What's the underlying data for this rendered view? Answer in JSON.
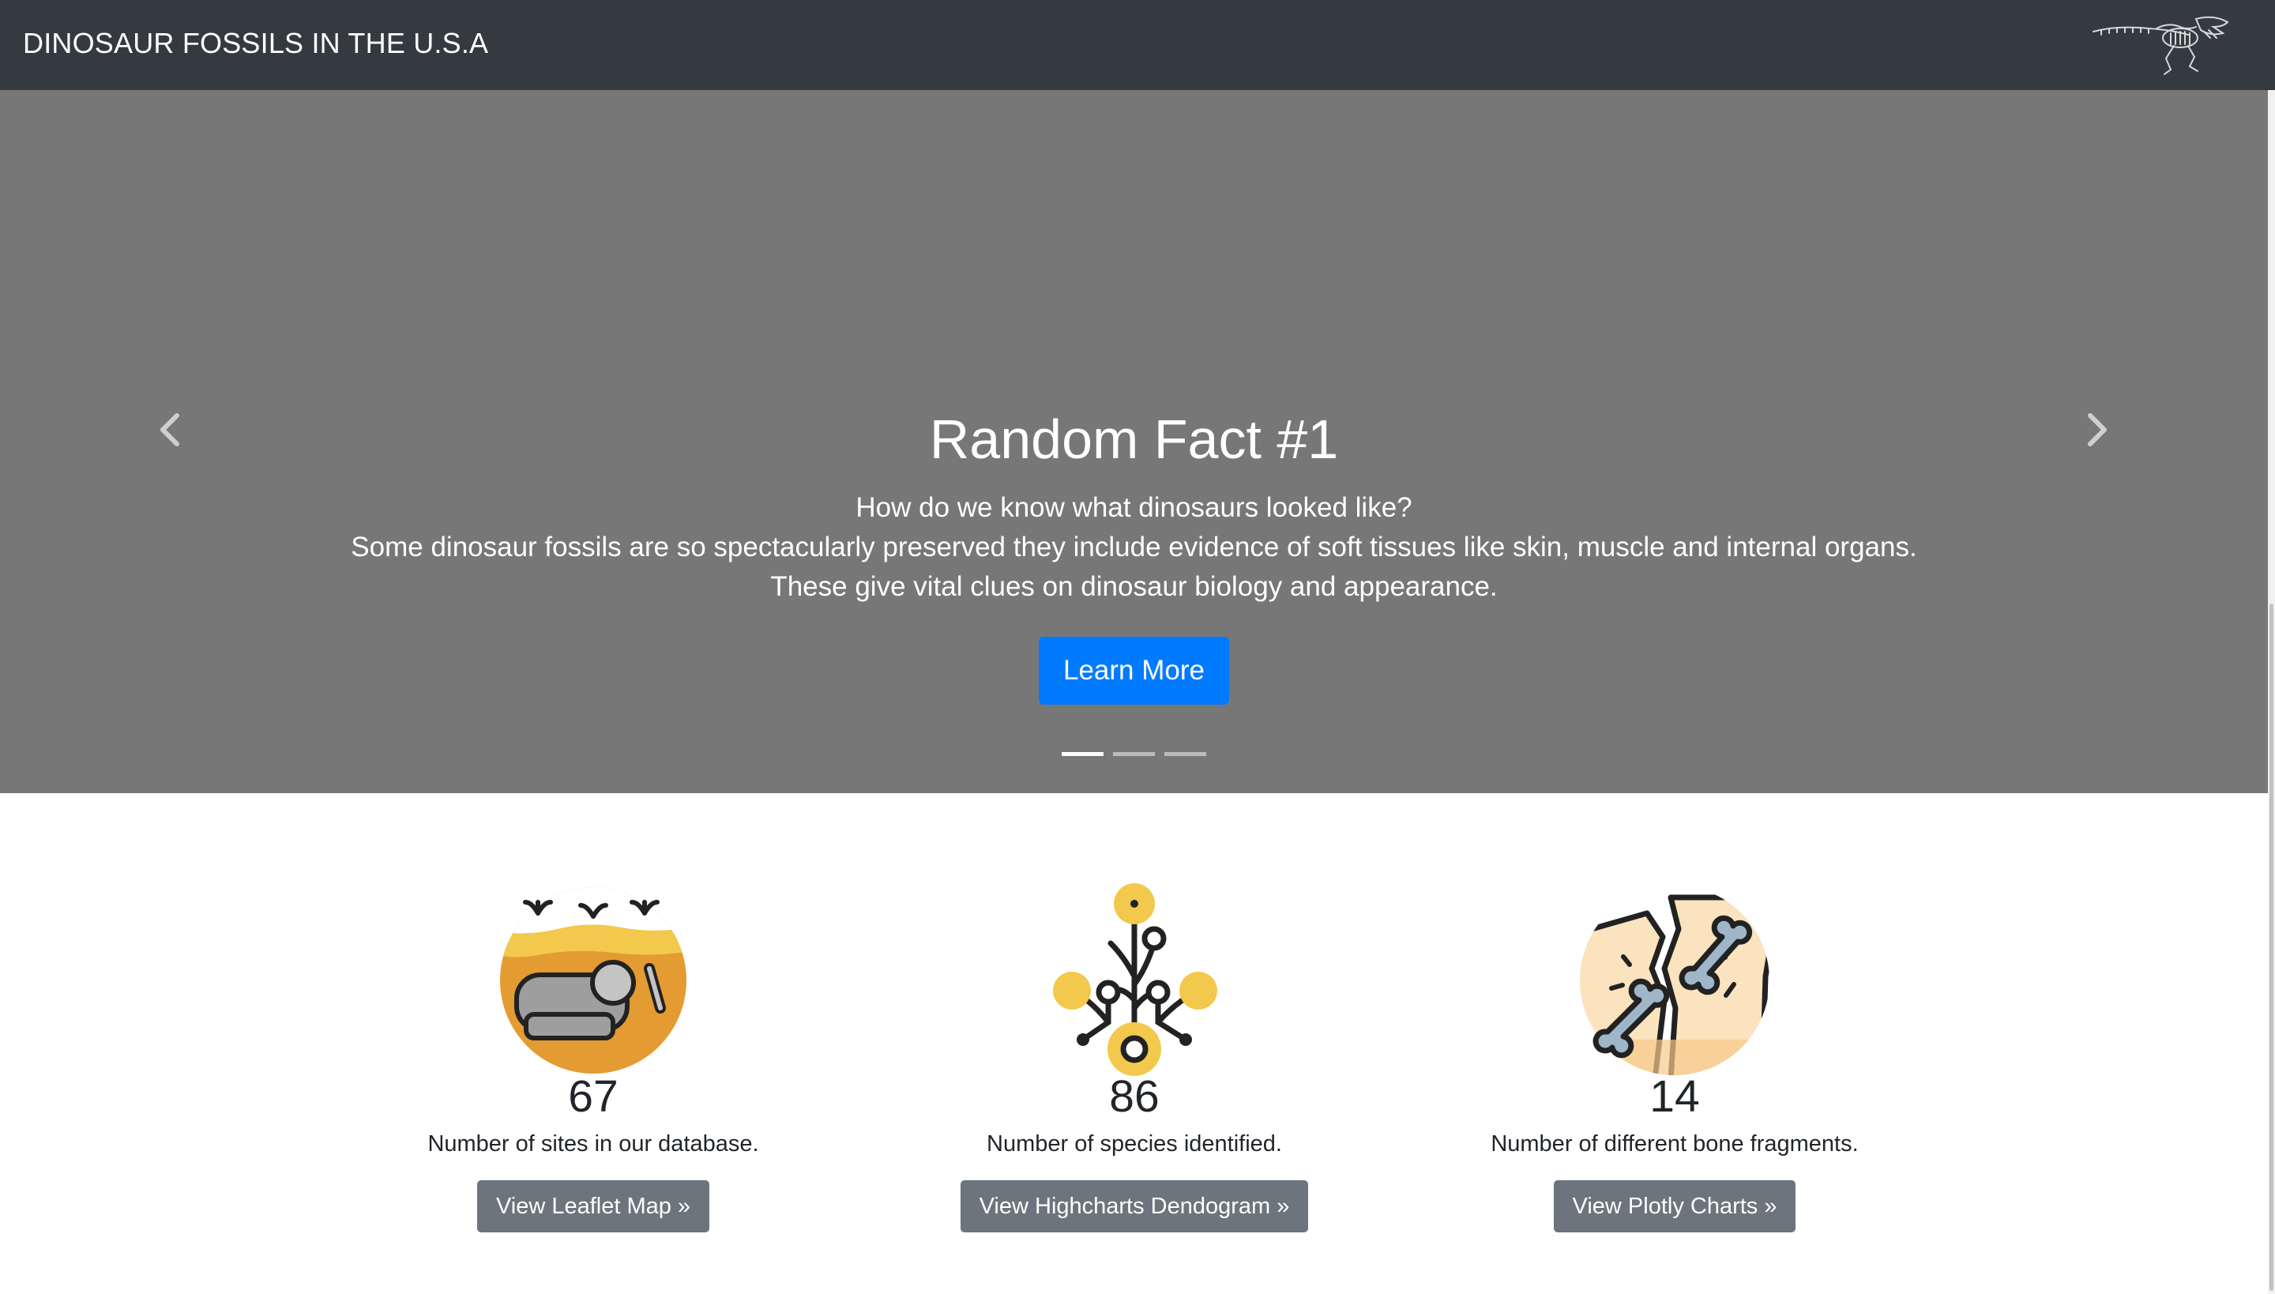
{
  "navbar": {
    "brand": "DINOSAUR FOSSILS IN THE U.S.A",
    "logo_icon": "trex-skeleton-icon"
  },
  "carousel": {
    "prev_icon": "chevron-left-icon",
    "next_icon": "chevron-right-icon",
    "background_color": "#777777",
    "slide": {
      "title": "Random Fact #1",
      "question": "How do we know what dinosaurs looked like?",
      "body": "Some dinosaur fossils are so spectacularly preserved they include evidence of soft tissues like skin, muscle and internal organs. These give vital clues on dinosaur biology and appearance.",
      "button_label": "Learn More"
    },
    "indicators": [
      {
        "active": true
      },
      {
        "active": false
      },
      {
        "active": false
      }
    ]
  },
  "features": [
    {
      "icon": "fossil-dig-site-icon",
      "number": "67",
      "description": "Number of sites in our database.",
      "button_label": "View Leaflet Map »"
    },
    {
      "icon": "dendrogram-tree-icon",
      "number": "86",
      "description": "Number of species identified.",
      "button_label": "View Highcharts Dendogram »"
    },
    {
      "icon": "bone-fragments-icon",
      "number": "14",
      "description": "Number of different bone fragments.",
      "button_label": "View Plotly Charts »"
    }
  ],
  "colors": {
    "navbar_bg": "#343a40",
    "primary": "#007bff",
    "secondary": "#6c757d",
    "accent_orange": "#e49b32",
    "accent_yellow": "#f2c94c"
  }
}
